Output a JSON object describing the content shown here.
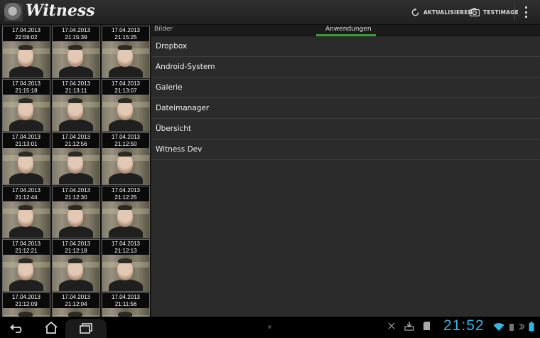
{
  "app": {
    "title": "Witness"
  },
  "actionbar": {
    "refresh_label": "AKTUALISIEREN",
    "testimage_label": "TESTIMAGE"
  },
  "tabs": [
    {
      "label": "Bilder"
    },
    {
      "label": "Anwendungen",
      "selected": true
    }
  ],
  "apps": [
    {
      "label": "Dropbox"
    },
    {
      "label": "Android-System"
    },
    {
      "label": "Galerie"
    },
    {
      "label": "Dateimanager"
    },
    {
      "label": "Übersicht"
    },
    {
      "label": "Witness Dev"
    }
  ],
  "photos": [
    {
      "date": "17.04.2013",
      "time": "22:59:02"
    },
    {
      "date": "17.04.2013",
      "time": "21:15:39"
    },
    {
      "date": "17.04.2013",
      "time": "21:15:25"
    },
    {
      "date": "17.04.2013",
      "time": "21:15:18"
    },
    {
      "date": "17.04.2013",
      "time": "21:13:11"
    },
    {
      "date": "17.04.2013",
      "time": "21:13:07"
    },
    {
      "date": "17.04.2013",
      "time": "21:13:01"
    },
    {
      "date": "17.04.2013",
      "time": "21:12:56"
    },
    {
      "date": "17.04.2013",
      "time": "21:12:50"
    },
    {
      "date": "17.04.2013",
      "time": "21:12:44"
    },
    {
      "date": "17.04.2013",
      "time": "21:12:30"
    },
    {
      "date": "17.04.2013",
      "time": "21:12:25"
    },
    {
      "date": "17.04.2013",
      "time": "21:12:21"
    },
    {
      "date": "17.04.2013",
      "time": "21:12:18"
    },
    {
      "date": "17.04.2013",
      "time": "21:12:13"
    },
    {
      "date": "17.04.2013",
      "time": "21:12:09"
    },
    {
      "date": "17.04.2013",
      "time": "21:12:04"
    },
    {
      "date": "17.04.2013",
      "time": "21:11:56"
    }
  ],
  "statusbar": {
    "clock": "21:52"
  },
  "colors": {
    "accent": "#33b5e5",
    "tab_indicator": "#3c9b34"
  }
}
